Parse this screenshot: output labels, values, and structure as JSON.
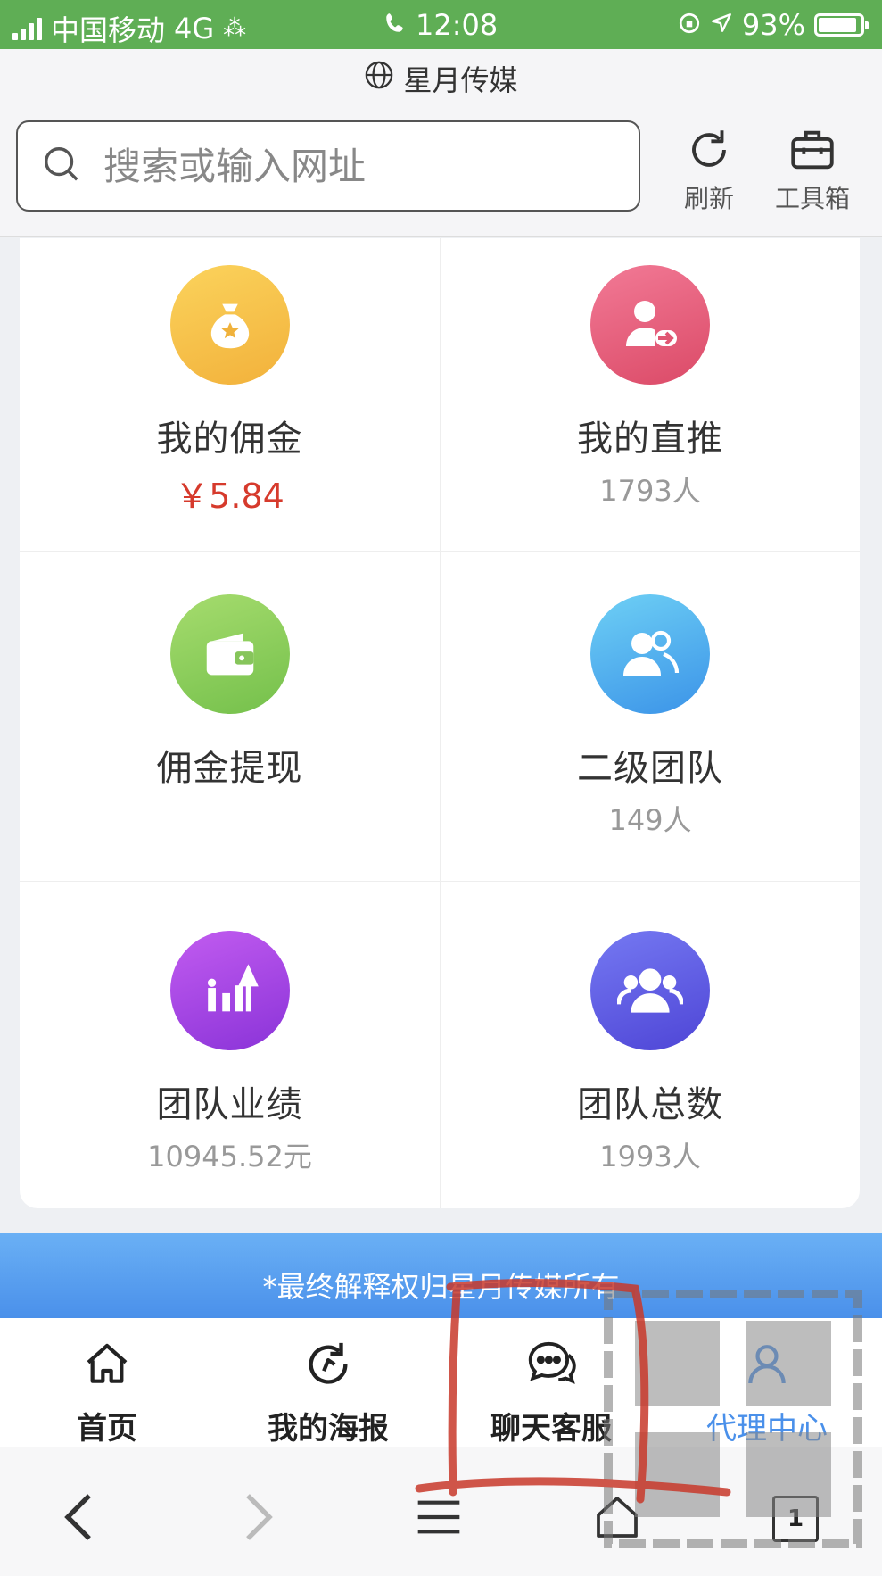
{
  "status_bar": {
    "carrier": "中国移动",
    "network": "4G",
    "time": "12:08",
    "battery": "93%"
  },
  "browser": {
    "site_title": "星月传媒",
    "search_placeholder": "搜索或输入网址",
    "refresh_label": "刷新",
    "toolbox_label": "工具箱",
    "tabs_count": "1"
  },
  "grid": {
    "items": [
      {
        "label": "我的佣金",
        "value": "￥5.84",
        "icon": "money-bag-icon",
        "color": "#f5c04a"
      },
      {
        "label": "我的直推",
        "value": "1793人",
        "icon": "user-transfer-icon",
        "color": "#e45c78"
      },
      {
        "label": "佣金提现",
        "value": "",
        "icon": "wallet-icon",
        "color": "#8ccc5a"
      },
      {
        "label": "二级团队",
        "value": "149人",
        "icon": "users-icon",
        "color": "#4aa8ee"
      },
      {
        "label": "团队业绩",
        "value": "10945.52元",
        "icon": "growth-chart-icon",
        "color": "#a845e4"
      },
      {
        "label": "团队总数",
        "value": "1993人",
        "icon": "group-icon",
        "color": "#5c58e2"
      }
    ]
  },
  "banner": {
    "text": "*最终解释权归星月传媒所有"
  },
  "tab_bar": {
    "tabs": [
      {
        "label": "首页",
        "icon": "home-icon"
      },
      {
        "label": "我的海报",
        "icon": "poster-refresh-icon"
      },
      {
        "label": "聊天客服",
        "icon": "chat-icon"
      },
      {
        "label": "代理中心",
        "icon": "agent-user-icon",
        "active": true
      }
    ]
  },
  "accent_color": "#4a90ea",
  "status_bar_color": "#5fae55"
}
